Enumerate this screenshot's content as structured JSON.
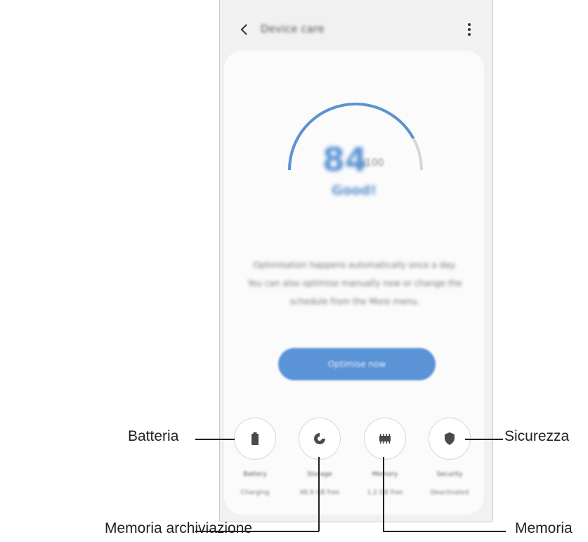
{
  "app": {
    "title": "Device care",
    "back_icon": "back-chevron-icon",
    "more_icon": "more-options-icon"
  },
  "score": {
    "value": "84",
    "max": "/100",
    "status": "Good!",
    "level": 0.84,
    "arc_color": "#5b93d3"
  },
  "description": "Optimisation happens automatically once a day. You can also optimise manually now or change the schedule from the More menu.",
  "optimize_button": "Optimise now",
  "tiles": [
    {
      "icon": "battery-icon",
      "label": "Battery",
      "sub": "Charging"
    },
    {
      "icon": "storage-pie-icon",
      "label": "Storage",
      "sub": "48.9 GB free"
    },
    {
      "icon": "memory-chip-icon",
      "label": "Memory",
      "sub": "1.2 GB free"
    },
    {
      "icon": "shield-icon",
      "label": "Security",
      "sub": "Deactivated"
    }
  ],
  "callouts": {
    "battery": "Batteria",
    "storage": "Memoria archiviazione",
    "security": "Sicurezza",
    "memory": "Memoria"
  }
}
